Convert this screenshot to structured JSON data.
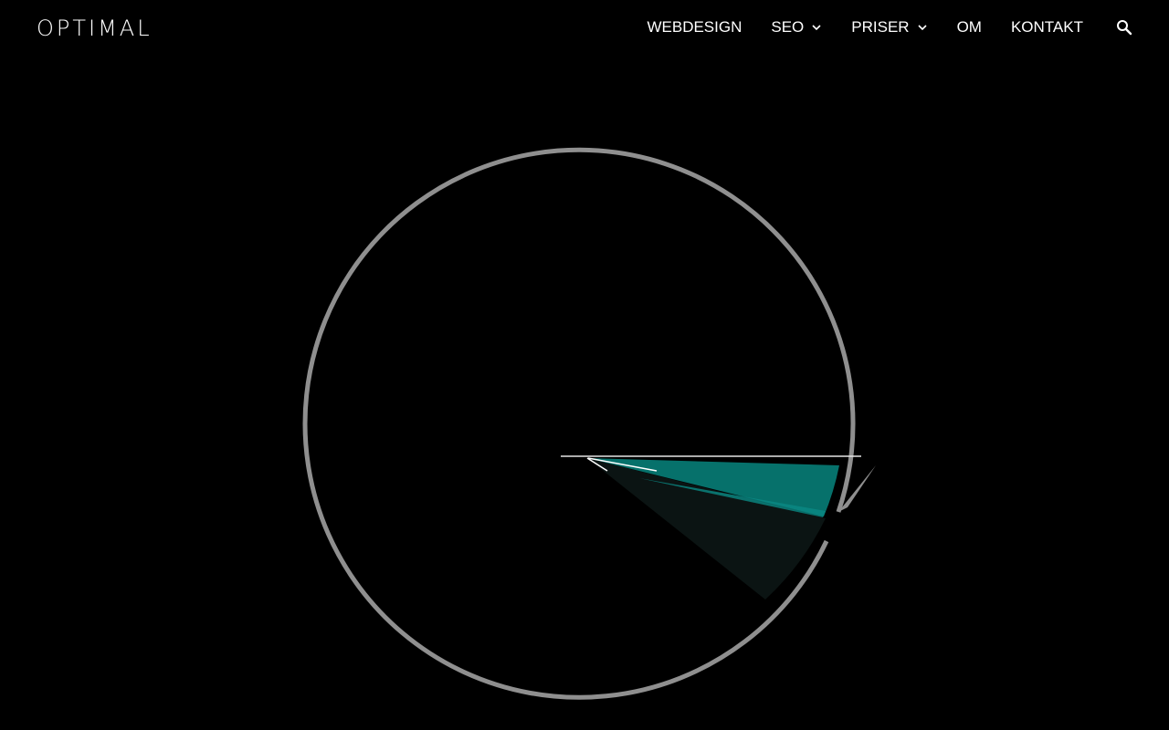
{
  "header": {
    "logo": "OPTIMAL",
    "nav": [
      {
        "label": "WEBDESIGN",
        "has_dropdown": false
      },
      {
        "label": "SEO",
        "has_dropdown": true
      },
      {
        "label": "PRISER",
        "has_dropdown": true
      },
      {
        "label": "OM",
        "has_dropdown": false
      },
      {
        "label": "KONTAKT",
        "has_dropdown": false
      }
    ],
    "search_icon": "search-icon"
  },
  "hero": {
    "ring_color": "#8f8f8f",
    "accent_color": "#06716b",
    "accent_light": "#0a8a84",
    "shadow_color": "#0b1413"
  }
}
